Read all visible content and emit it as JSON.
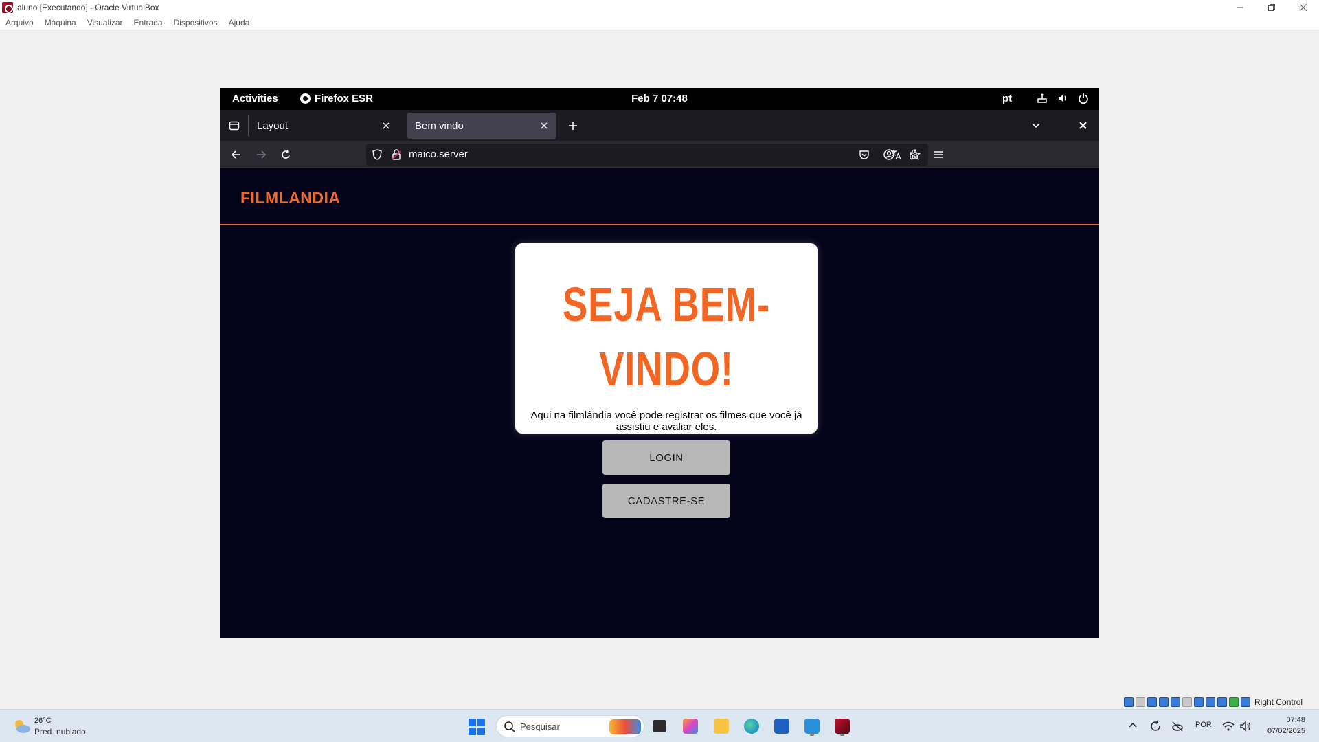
{
  "host_window": {
    "title": "aluno [Executando] - Oracle VirtualBox",
    "menu": [
      "Arquivo",
      "Máquina",
      "Visualizar",
      "Entrada",
      "Dispositivos",
      "Ajuda"
    ]
  },
  "gnome_topbar": {
    "activities": "Activities",
    "app_name": "Firefox ESR",
    "clock": "Feb 7  07:48",
    "language": "pt"
  },
  "browser": {
    "tabs": [
      {
        "label": "Layout",
        "active": false
      },
      {
        "label": "Bem vindo",
        "active": true
      }
    ],
    "url": "maico.server"
  },
  "page": {
    "logo": "FILMLANDIA",
    "welcome_title_line1": "SEJA BEM-",
    "welcome_title_line2": "VINDO!",
    "welcome_text": "Aqui na filmlândia você pode registrar os filmes que você já assistiu e avaliar eles.",
    "login_button": "LOGIN",
    "signup_button": "CADASTRE-SE",
    "colors": {
      "accent": "#f26522",
      "background": "#05031a"
    }
  },
  "vbox_status": {
    "host_key": "Right Control"
  },
  "taskbar": {
    "weather_temp": "26°C",
    "weather_desc": "Pred. nublado",
    "search_placeholder": "Pesquisar",
    "input_lang": "POR",
    "time": "07:48",
    "date": "07/02/2025"
  }
}
